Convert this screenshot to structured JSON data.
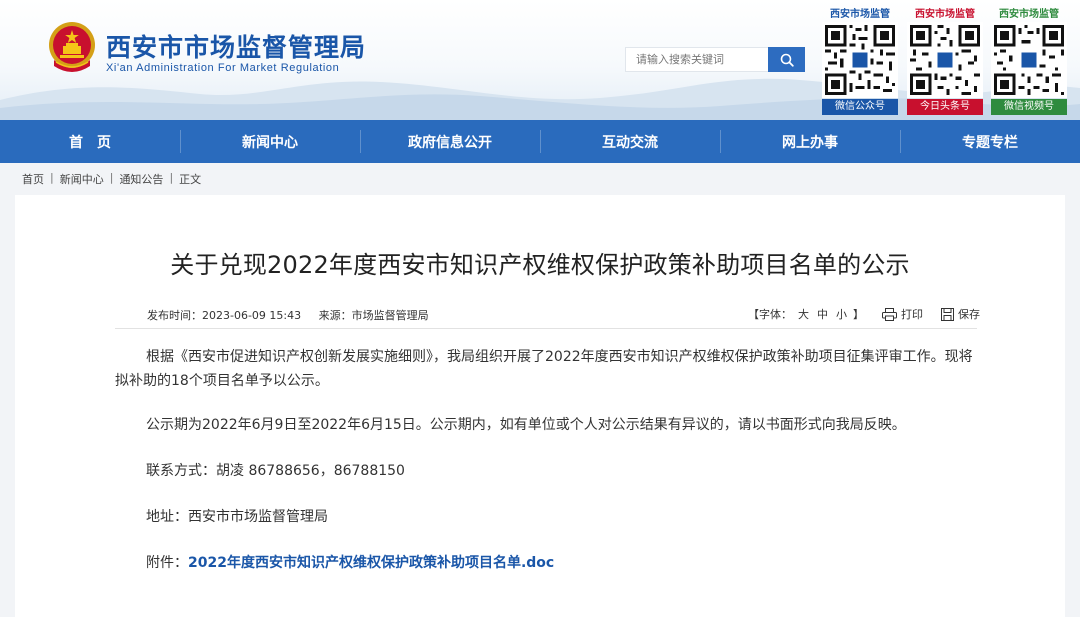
{
  "header": {
    "title": "西安市市场监督管理局",
    "subtitle": "Xi'an Administration For Market Regulation",
    "search_placeholder": "请输入搜索关键词",
    "qr_codes": [
      {
        "top_label": "西安市场监管",
        "bottom_label": "微信公众号",
        "top_color": "#1a56a8",
        "bottom_bg": "#1a56a8"
      },
      {
        "top_label": "西安市场监管",
        "bottom_label": "今日头条号",
        "top_color": "#c8102e",
        "bottom_bg": "#c8102e"
      },
      {
        "top_label": "西安市场监管",
        "bottom_label": "微信视频号",
        "top_color": "#2e8b3e",
        "bottom_bg": "#2e8b3e"
      }
    ]
  },
  "nav": {
    "items": [
      "首　页",
      "新闻中心",
      "政府信息公开",
      "互动交流",
      "网上办事",
      "专题专栏"
    ]
  },
  "breadcrumb": {
    "items": [
      "首页",
      "新闻中心",
      "通知公告",
      "正文"
    ],
    "separator": "|"
  },
  "article": {
    "title": "关于兑现2022年度西安市知识产权维权保护政策补助项目名单的公示",
    "publish_label": "发布时间：",
    "publish_time": "2023-06-09 15:43",
    "source_label": "来源：",
    "source": "市场监督管理局",
    "font_label_open": "【字体：",
    "font_large": "大",
    "font_medium": "中",
    "font_small": "小",
    "font_label_close": "】",
    "print_label": "打印",
    "save_label": "保存",
    "para1": "根据《西安市促进知识产权创新发展实施细则》，我局组织开展了2022年度西安市知识产权维权保护政策补助项目征集评审工作。现将拟补助的18个项目名单予以公示。",
    "para2": "公示期为2022年6月9日至2022年6月15日。公示期内，如有单位或个人对公示结果有异议的，请以书面形式向我局反映。",
    "para3": "联系方式：胡凌 86788656，86788150",
    "para4": "地址：西安市市场监督管理局",
    "attachment_label": "附件：",
    "attachment_link": "2022年度西安市知识产权维权保护政策补助项目名单.doc"
  },
  "colors": {
    "brand_blue": "#1a56a8",
    "nav_blue": "#2a6bbd",
    "search_button": "#2d6cc0"
  }
}
